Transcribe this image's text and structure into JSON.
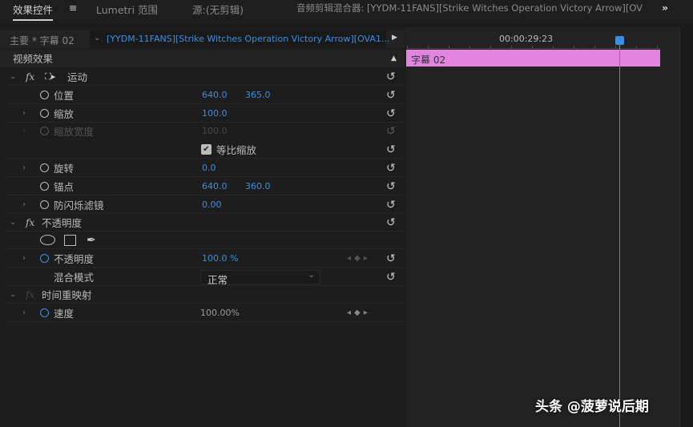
{
  "tabs": [
    {
      "label": "效果控件",
      "active": true
    },
    {
      "label": "Lumetri 范围"
    },
    {
      "label": "源:(无剪辑)"
    },
    {
      "label": "音频剪辑混合器: [YYDM-11FANS][Strike Witches Operation Victory Arrow][OV"
    }
  ],
  "tab_menu_icon": "≡",
  "overflow_icon": "»",
  "header": {
    "source": "主要 * 字幕 02",
    "clip": "[YYDM-11FANS][Strike Witches Operation Victory Arrow][OVA1..."
  },
  "timeline": {
    "timecode": "00:00:29:23",
    "clip_label": "字幕 02",
    "clip_color": "#e385e0",
    "playhead_color": "#3b8fe0"
  },
  "section_title": "视频效果",
  "motion": {
    "label": "运动",
    "position": {
      "label": "位置",
      "x": "640.0",
      "y": "365.0"
    },
    "scale": {
      "label": "缩放",
      "value": "100.0"
    },
    "scale_width": {
      "label": "缩放宽度",
      "value": "100.0"
    },
    "uniform_scale": {
      "label": "等比缩放",
      "checked": true
    },
    "rotation": {
      "label": "旋转",
      "value": "0.0"
    },
    "anchor": {
      "label": "锚点",
      "x": "640.0",
      "y": "360.0"
    },
    "anti_flicker": {
      "label": "防闪烁滤镜",
      "value": "0.00"
    }
  },
  "opacity": {
    "label": "不透明度",
    "opacity": {
      "label": "不透明度",
      "value": "100.0 %"
    },
    "blend": {
      "label": "混合模式",
      "value": "正常"
    }
  },
  "time_remap": {
    "label": "时间重映射",
    "speed": {
      "label": "速度",
      "value": "100.00%"
    }
  },
  "watermark": "头条 @菠萝说后期"
}
